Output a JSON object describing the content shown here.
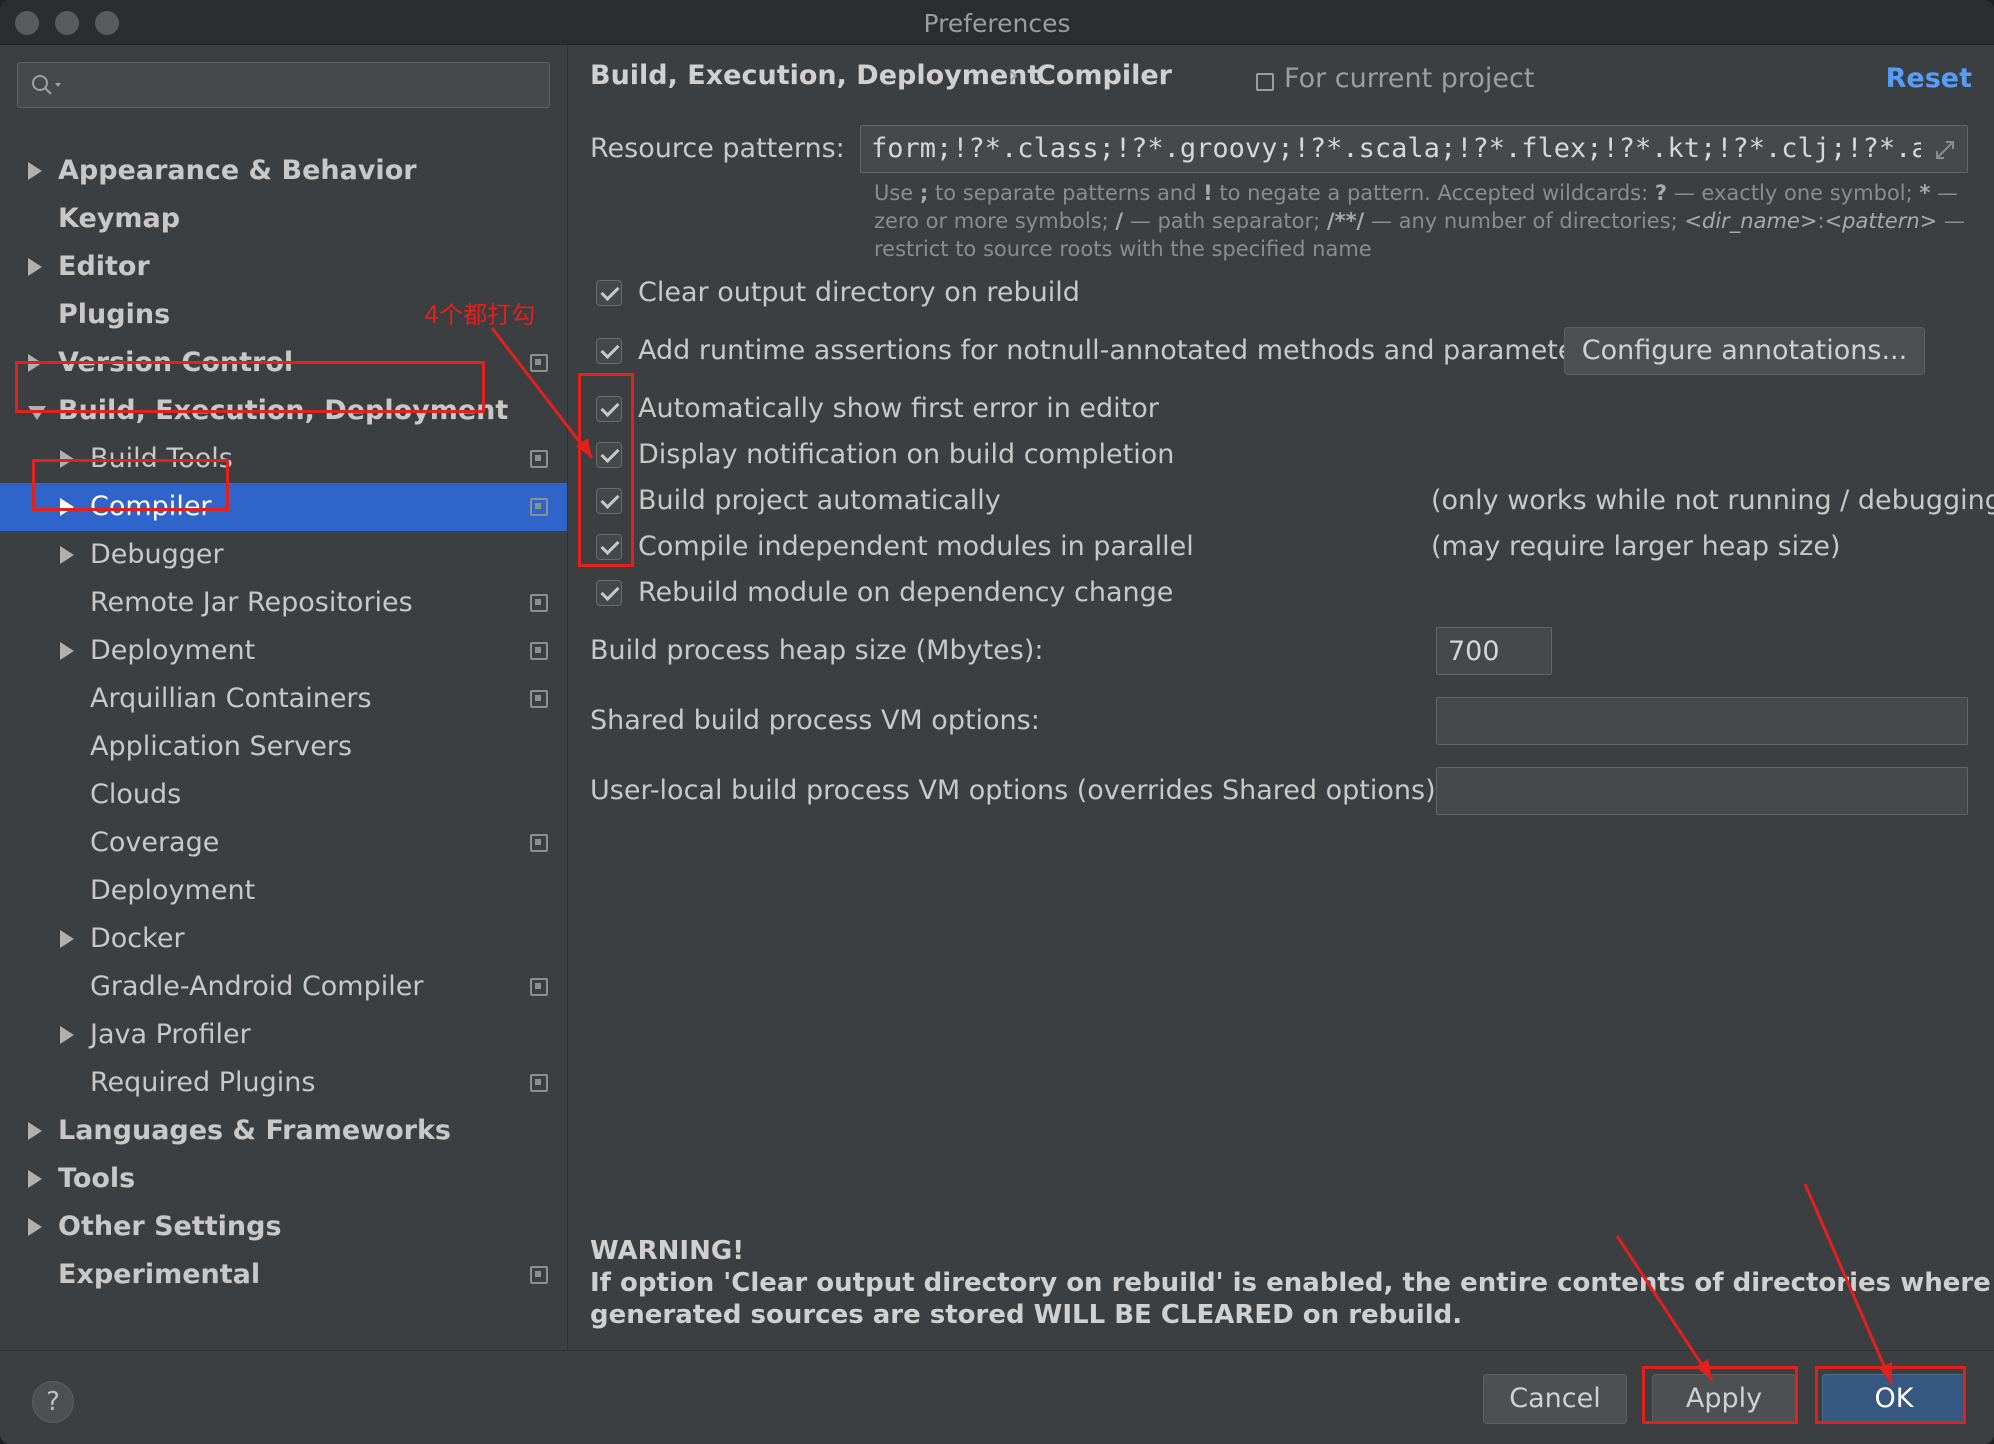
{
  "window": {
    "title": "Preferences"
  },
  "search": {
    "placeholder": ""
  },
  "sidebar": {
    "items": [
      {
        "label": "Appearance & Behavior",
        "level": 0,
        "arrow": "right",
        "project_icon": false
      },
      {
        "label": "Keymap",
        "level": 0,
        "arrow": "none",
        "project_icon": false
      },
      {
        "label": "Editor",
        "level": 0,
        "arrow": "right",
        "project_icon": false
      },
      {
        "label": "Plugins",
        "level": 0,
        "arrow": "none",
        "project_icon": false
      },
      {
        "label": "Version Control",
        "level": 0,
        "arrow": "right",
        "project_icon": true
      },
      {
        "label": "Build, Execution, Deployment",
        "level": 0,
        "arrow": "down",
        "project_icon": false
      },
      {
        "label": "Build Tools",
        "level": 1,
        "arrow": "right",
        "project_icon": true
      },
      {
        "label": "Compiler",
        "level": 1,
        "arrow": "right",
        "project_icon": true,
        "selected": true
      },
      {
        "label": "Debugger",
        "level": 1,
        "arrow": "right",
        "project_icon": false
      },
      {
        "label": "Remote Jar Repositories",
        "level": 1,
        "arrow": "none",
        "project_icon": true
      },
      {
        "label": "Deployment",
        "level": 1,
        "arrow": "right",
        "project_icon": true
      },
      {
        "label": "Arquillian Containers",
        "level": 1,
        "arrow": "none",
        "project_icon": true
      },
      {
        "label": "Application Servers",
        "level": 1,
        "arrow": "none",
        "project_icon": false
      },
      {
        "label": "Clouds",
        "level": 1,
        "arrow": "none",
        "project_icon": false
      },
      {
        "label": "Coverage",
        "level": 1,
        "arrow": "none",
        "project_icon": true
      },
      {
        "label": "Deployment",
        "level": 1,
        "arrow": "none",
        "project_icon": false
      },
      {
        "label": "Docker",
        "level": 1,
        "arrow": "right",
        "project_icon": false
      },
      {
        "label": "Gradle-Android Compiler",
        "level": 1,
        "arrow": "none",
        "project_icon": true
      },
      {
        "label": "Java Profiler",
        "level": 1,
        "arrow": "right",
        "project_icon": false
      },
      {
        "label": "Required Plugins",
        "level": 1,
        "arrow": "none",
        "project_icon": true
      },
      {
        "label": "Languages & Frameworks",
        "level": 0,
        "arrow": "right",
        "project_icon": false
      },
      {
        "label": "Tools",
        "level": 0,
        "arrow": "right",
        "project_icon": false
      },
      {
        "label": "Other Settings",
        "level": 0,
        "arrow": "right",
        "project_icon": false
      },
      {
        "label": "Experimental",
        "level": 0,
        "arrow": "none",
        "project_icon": true
      }
    ]
  },
  "header": {
    "breadcrumb_parent": "Build, Execution, Deployment",
    "breadcrumb_separator": "›",
    "breadcrumb_current": "Compiler",
    "scope": "For current project",
    "reset": "Reset"
  },
  "compiler": {
    "resource_patterns_label": "Resource patterns:",
    "resource_patterns_value": "form;!?*.class;!?*.groovy;!?*.scala;!?*.flex;!?*.kt;!?*.clj;!?*.aj",
    "hint_use": "Use",
    "hint_sep": ";",
    "hint_text1": "to separate patterns and",
    "hint_bang": "!",
    "hint_text2": "to negate a pattern. Accepted wildcards:",
    "hint_q": "?",
    "hint_text3": "— exactly one symbol;",
    "hint_star": "*",
    "hint_text4": "— zero or more symbols;",
    "hint_slash": "/",
    "hint_text5": "— path separator;",
    "hint_dstar": "/**/",
    "hint_text6": "— any number of directories;",
    "hint_dirname": "<dir_name>",
    "hint_colon": ":",
    "hint_pattern": "<pattern>",
    "hint_text7": "— restrict to source roots with the specified name",
    "checkboxes": [
      {
        "label": "Clear output directory on rebuild",
        "checked": true
      },
      {
        "label": "Add runtime assertions for notnull-annotated methods and parameters",
        "checked": true
      },
      {
        "label": "Automatically show first error in editor",
        "checked": true
      },
      {
        "label": "Display notification on build completion",
        "checked": true
      },
      {
        "label": "Build project automatically",
        "checked": true
      },
      {
        "label": "Compile independent modules in parallel",
        "checked": true
      },
      {
        "label": "Rebuild module on dependency change",
        "checked": true
      }
    ],
    "configure_annotations": "Configure annotations...",
    "note_auto_build": "(only works while not running / debugging)",
    "note_parallel": "(may require larger heap size)",
    "heap_label": "Build process heap size (Mbytes):",
    "heap_value": "700",
    "shared_vm_label": "Shared build process VM options:",
    "shared_vm_value": "",
    "local_vm_label": "User-local build process VM options (overrides Shared options):",
    "local_vm_value": "",
    "warning_title": "WARNING!",
    "warning_line1": "If option 'Clear output directory on rebuild' is enabled, the entire contents of directories where",
    "warning_line2": "generated sources are stored WILL BE CLEARED on rebuild."
  },
  "footer": {
    "help": "?",
    "cancel": "Cancel",
    "apply": "Apply",
    "ok": "OK"
  },
  "annotation": {
    "text": "4个都打勾",
    "color": "#e2211c"
  }
}
